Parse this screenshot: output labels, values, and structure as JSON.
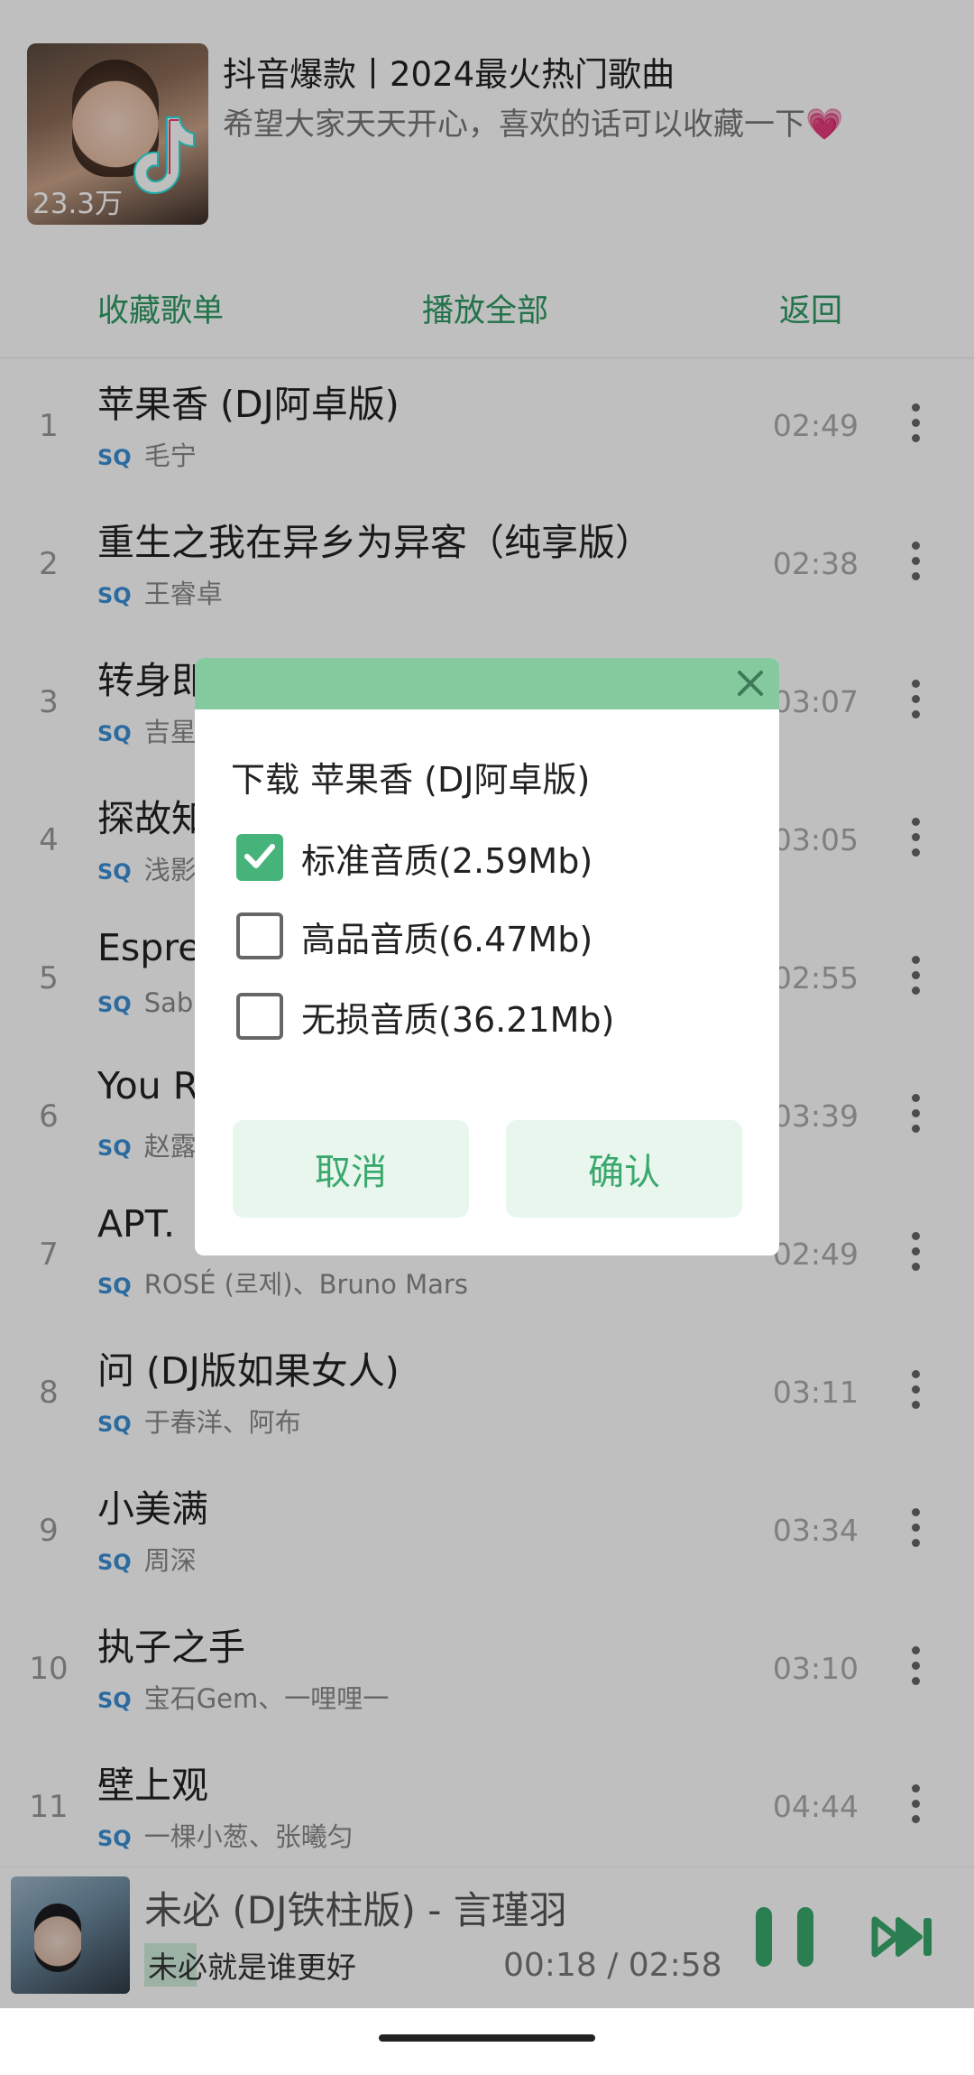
{
  "playlist": {
    "title": "抖音爆款丨2024最火热门歌曲",
    "description": "希望大家天天开心，喜欢的话可以收藏一下",
    "play_count": "23.3万",
    "icons": {
      "heart": "💗",
      "tiktok_logo": "tiktok-logo-icon"
    }
  },
  "actions": {
    "collect": "收藏歌单",
    "play_all": "播放全部",
    "back": "返回"
  },
  "songs": [
    {
      "num": "1",
      "title": "苹果香 (DJ阿卓版)",
      "quality": "SQ",
      "artist": "毛宁",
      "duration": "02:49"
    },
    {
      "num": "2",
      "title": "重生之我在异乡为异客（纯享版）",
      "quality": "SQ",
      "artist": "王睿卓",
      "duration": "02:38"
    },
    {
      "num": "3",
      "title": "转身即",
      "quality": "SQ",
      "artist": "吉星",
      "duration": "03:07"
    },
    {
      "num": "4",
      "title": "探故知",
      "quality": "SQ",
      "artist": "浅影",
      "duration": "03:05"
    },
    {
      "num": "5",
      "title": "Espre",
      "quality": "SQ",
      "artist": "Sabr",
      "duration": "02:55"
    },
    {
      "num": "6",
      "title": "You R",
      "quality": "SQ",
      "artist": "赵露",
      "duration": "03:39"
    },
    {
      "num": "7",
      "title": "APT.",
      "quality": "SQ",
      "artist": "ROSÉ (로제)、Bruno Mars",
      "duration": "02:49"
    },
    {
      "num": "8",
      "title": "问 (DJ版如果女人)",
      "quality": "SQ",
      "artist": "于春洋、阿布",
      "duration": "03:11"
    },
    {
      "num": "9",
      "title": "小美满",
      "quality": "SQ",
      "artist": "周深",
      "duration": "03:34"
    },
    {
      "num": "10",
      "title": "执子之手",
      "quality": "SQ",
      "artist": "宝石Gem、一哩哩一",
      "duration": "03:10"
    },
    {
      "num": "11",
      "title": "壁上观",
      "quality": "SQ",
      "artist": "一棵小葱、张曦匀",
      "duration": "04:44"
    }
  ],
  "now_playing": {
    "title": "未必 (DJ铁柱版) - 言瑾羽",
    "lyric": "未必就是谁更好",
    "time": "00:18 / 02:58"
  },
  "dialog": {
    "title": "下载 苹果香 (DJ阿卓版)",
    "options": [
      {
        "label": "标准音质(2.59Mb)",
        "checked": true
      },
      {
        "label": "高品音质(6.47Mb)",
        "checked": false
      },
      {
        "label": "无损音质(36.21Mb)",
        "checked": false
      }
    ],
    "cancel": "取消",
    "confirm": "确认"
  },
  "colors": {
    "accent_green": "#2e9a63",
    "dialog_header": "#85ca9f",
    "checkbox_checked": "#46b47a",
    "button_bg": "#e8f6ee",
    "sq_blue": "#3a8fd6"
  }
}
